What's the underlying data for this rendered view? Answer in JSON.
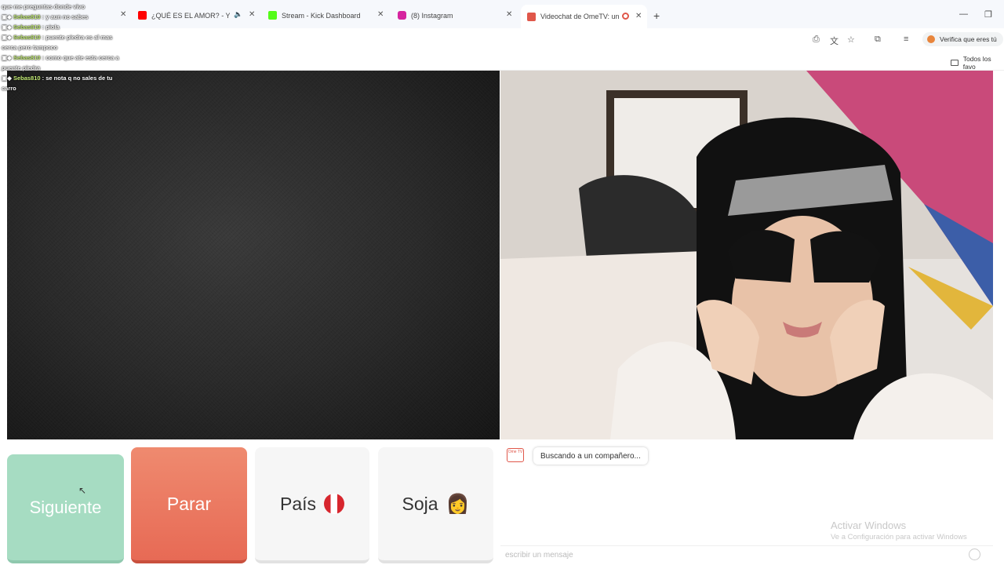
{
  "tabs": [
    {
      "title": "",
      "favicon_color": "#1a73e8"
    },
    {
      "title": "¿QUÉ ES EL AMOR? - YouT…",
      "favicon_color": "#ff0000"
    },
    {
      "title": "Stream - Kick Dashboard",
      "favicon_color": "#53fc18"
    },
    {
      "title": "(8) Instagram",
      "favicon_color": "#d6249f"
    },
    {
      "title": "Videochat de OmeTV: una…",
      "favicon_color": "#e0574a"
    }
  ],
  "toolbar": {
    "verify_label": "Verifica que eres tú"
  },
  "bookmarks": {
    "all_favorites": "Todos los favo"
  },
  "stream_chat": [
    {
      "user": "",
      "text": "que me preguntas donde vivo"
    },
    {
      "user": "Sebas810",
      "text": ": y aun no sabes"
    },
    {
      "user": "Sebas810",
      "text": ": piola"
    },
    {
      "user": "Sebas810",
      "text": ": puente piedra es al mas cerca pero tampoco"
    },
    {
      "user": "Sebas810",
      "text": ": como que ate esta cerca a puente piedra"
    },
    {
      "user": "Sebas810",
      "text": ": se nota q no sales de tu carro"
    }
  ],
  "controls": {
    "next": "Siguiente",
    "stop": "Parar",
    "country": "País",
    "gender": "Soja",
    "gender_emoji": "👩"
  },
  "chat_panel": {
    "logo": "Ome TV",
    "status": "Buscando a un compañero...",
    "input_placeholder": "escribir un mensaje"
  },
  "watermark": {
    "title": "Activar Windows",
    "subtitle": "Ve a Configuración para activar Windows"
  }
}
